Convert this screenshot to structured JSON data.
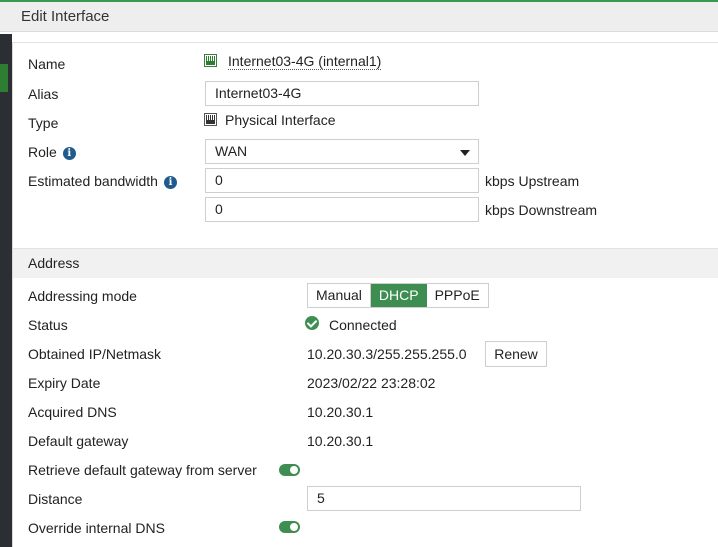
{
  "dialog": {
    "title": "Edit Interface"
  },
  "form": {
    "name_label": "Name",
    "name_value": "Internet03-4G (internal1)",
    "alias_label": "Alias",
    "alias_value": "Internet03-4G",
    "type_label": "Type",
    "type_value": "Physical Interface",
    "role_label": "Role",
    "role_value": "WAN",
    "bandwidth_label": "Estimated bandwidth",
    "upstream_value": "0",
    "upstream_unit": "kbps Upstream",
    "downstream_value": "0",
    "downstream_unit": "kbps Downstream"
  },
  "address": {
    "section_title": "Address",
    "mode_label": "Addressing mode",
    "modes": [
      "Manual",
      "DHCP",
      "PPPoE"
    ],
    "active_mode": "DHCP",
    "status_label": "Status",
    "status_value": "Connected",
    "ip_label": "Obtained IP/Netmask",
    "ip_value": "10.20.30.3/255.255.255.0",
    "renew_label": "Renew",
    "expiry_label": "Expiry Date",
    "expiry_value": "2023/02/22 23:28:02",
    "dns_label": "Acquired DNS",
    "dns_value": "10.20.30.1",
    "gateway_label": "Default gateway",
    "gateway_value": "10.20.30.1",
    "retrieve_label": "Retrieve default gateway from server",
    "retrieve_enabled": true,
    "distance_label": "Distance",
    "distance_value": "5",
    "override_label": "Override internal DNS",
    "override_enabled": true
  },
  "colors": {
    "accent": "#3e8e51",
    "info": "#1f5b8c"
  },
  "icons": {
    "info": "info-icon",
    "status": "check-circle-icon",
    "interface": "network-port-icon"
  }
}
